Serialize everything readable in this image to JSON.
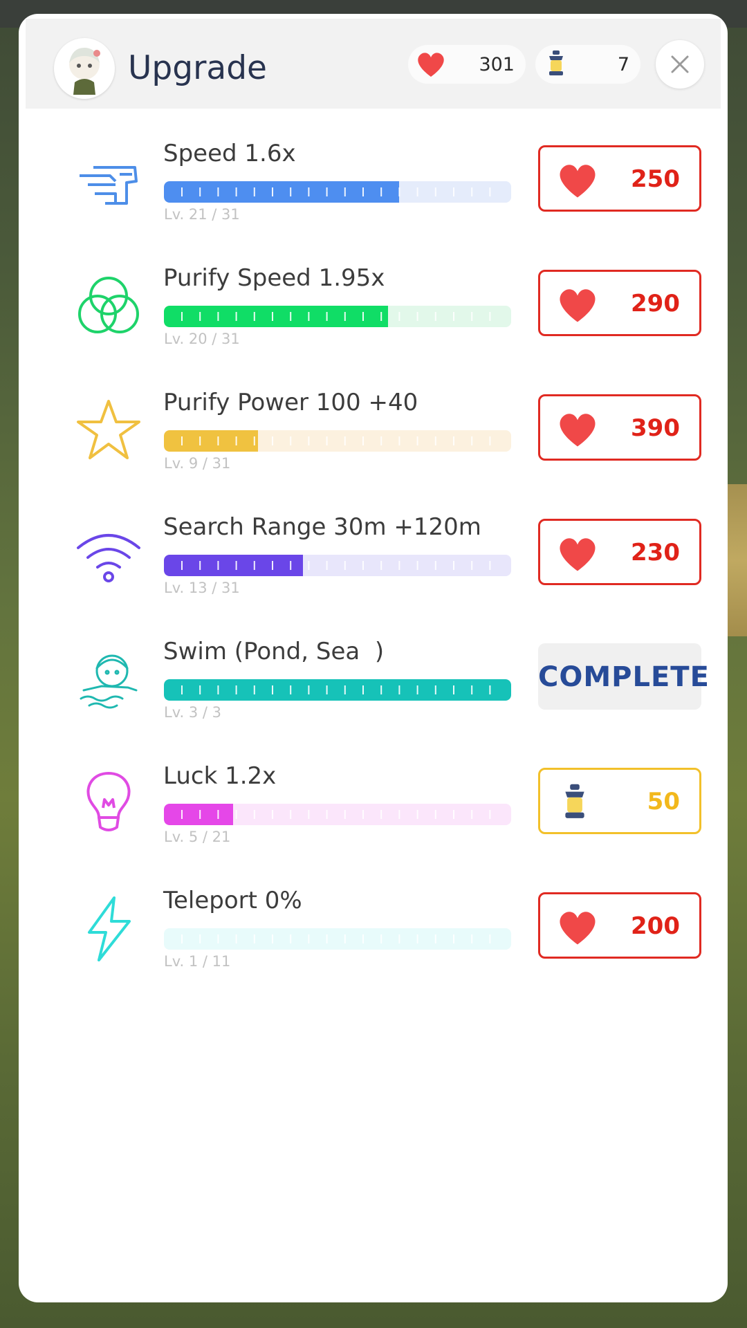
{
  "header": {
    "title": "Upgrade",
    "hearts": "301",
    "lanterns": "7"
  },
  "upgrades": [
    {
      "label": "Speed 1.6x",
      "level": "Lv. 21 / 31",
      "progress": 0.677,
      "color": "#4e8ef0",
      "track": "#e5ecfb",
      "icon": "winged-boot-icon",
      "cost": "250",
      "currency": "heart",
      "state": "buy"
    },
    {
      "label": "Purify Speed 1.95x",
      "level": "Lv. 20 / 31",
      "progress": 0.645,
      "color": "#10dd66",
      "track": "#e2f8ea",
      "icon": "triple-circles-icon",
      "cost": "290",
      "currency": "heart",
      "state": "buy"
    },
    {
      "label": "Purify Power 100 +40",
      "level": "Lv. 9 / 31",
      "progress": 0.27,
      "color": "#f0c240",
      "track": "#fcf1df",
      "icon": "star-icon",
      "cost": "390",
      "currency": "heart",
      "state": "buy"
    },
    {
      "label": "Search Range 30m +120m",
      "level": "Lv. 13 / 31",
      "progress": 0.4,
      "color": "#6a46e8",
      "track": "#e8e6fb",
      "icon": "signal-icon",
      "cost": "230",
      "currency": "heart",
      "state": "buy"
    },
    {
      "label": "Swim (Pond, Sea  )",
      "level": "Lv. 3 / 3",
      "progress": 1.0,
      "color": "#16c2b8",
      "track": "#dff6f4",
      "icon": "swimmer-icon",
      "cost": "COMPLETE",
      "currency": "none",
      "state": "complete"
    },
    {
      "label": "Luck 1.2x",
      "level": "Lv. 5 / 21",
      "progress": 0.2,
      "color": "#e547e8",
      "track": "#fbe6fb",
      "icon": "lightbulb-icon",
      "cost": "50",
      "currency": "lantern",
      "state": "buy"
    },
    {
      "label": "Teleport 0%",
      "level": "Lv. 1 / 11",
      "progress": 0.0,
      "color": "#36e0dc",
      "track": "#e8fbfb",
      "icon": "lightning-icon",
      "cost": "200",
      "currency": "heart",
      "state": "buy"
    }
  ]
}
